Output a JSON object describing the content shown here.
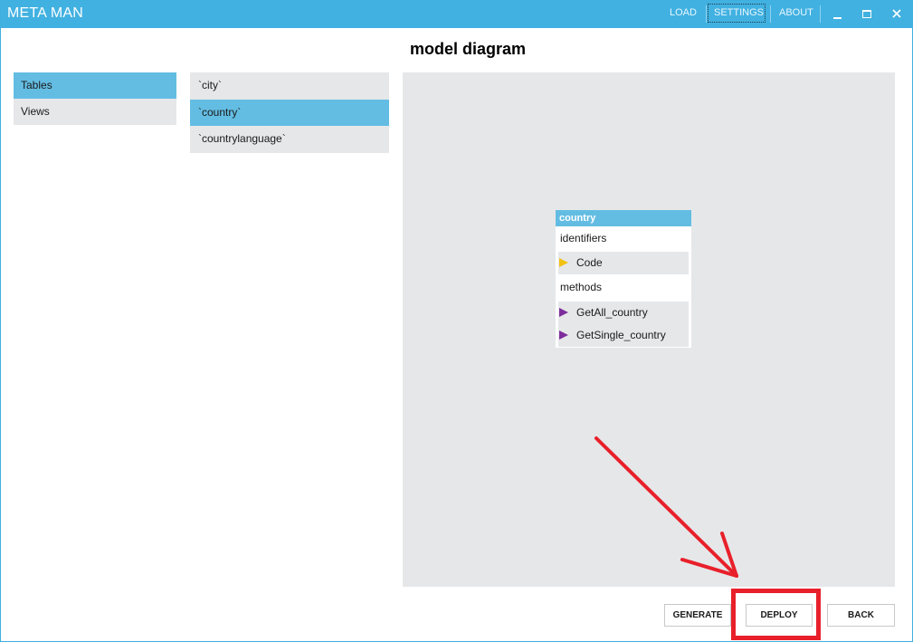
{
  "app": {
    "title": "META MAN"
  },
  "titlebar": {
    "menu": {
      "load": "LOAD",
      "settings": "SETTINGS",
      "about": "ABOUT"
    }
  },
  "page": {
    "title": "model diagram"
  },
  "categories": [
    {
      "label": "Tables",
      "selected": true
    },
    {
      "label": "Views",
      "selected": false
    }
  ],
  "tables": [
    {
      "label": "`city`",
      "selected": false
    },
    {
      "label": "`country`",
      "selected": true
    },
    {
      "label": "`countrylanguage`",
      "selected": false
    }
  ],
  "entity": {
    "name": "country",
    "identifiers_label": "identifiers",
    "identifiers": [
      "Code"
    ],
    "methods_label": "methods",
    "methods": [
      "GetAll_country",
      "GetSingle_country"
    ]
  },
  "buttons": {
    "generate": "GENERATE",
    "deploy": "DEPLOY",
    "back": "BACK"
  },
  "colors": {
    "titlebar": "#41b1e1",
    "selection": "#63bde3",
    "panel": "#e6e7e9",
    "key_marker": "#f3c114",
    "method_marker": "#7d2d9c",
    "annotation": "#e8202a"
  }
}
